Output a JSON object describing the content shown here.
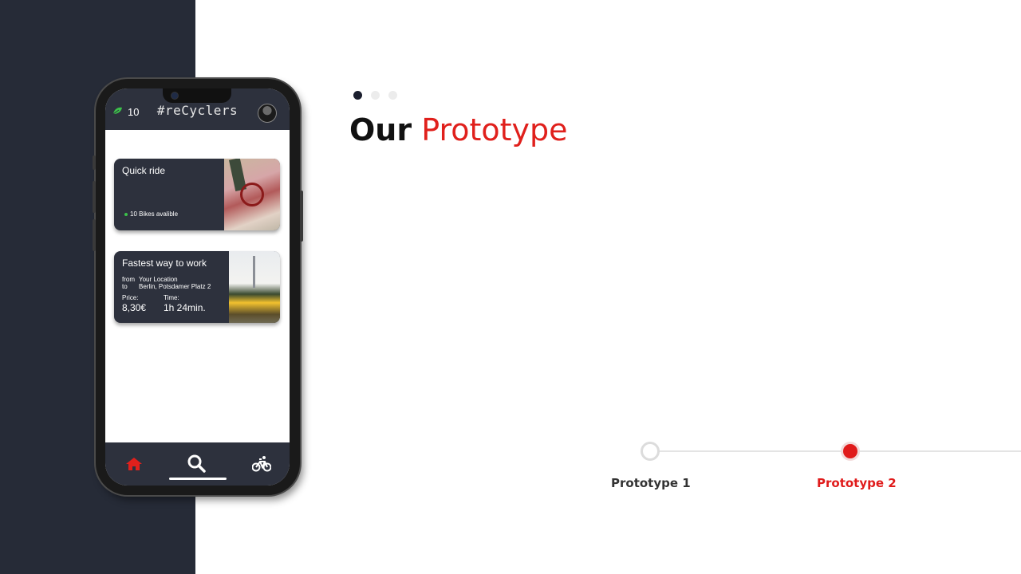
{
  "slide": {
    "title_bold": "Our",
    "title_accent": "Prototype",
    "accent_color": "#e0201c",
    "pager_dots": [
      {
        "active": true
      },
      {
        "active": false
      },
      {
        "active": false
      }
    ]
  },
  "phone": {
    "header": {
      "leaf_icon": "leaf-icon",
      "points": "10",
      "app_title": "#reCyclers",
      "avatar_icon": "user-avatar"
    },
    "cards": [
      {
        "title": "Quick ride",
        "status": "10 Bikes avalible",
        "status_color": "#3cc24a",
        "image": "folding-bike-photo"
      },
      {
        "title": "Fastest way to work",
        "from_label": "from",
        "from_value": "Your Location",
        "to_label": "to",
        "to_value": "Berlin, Potsdamer Platz 2",
        "price_label": "Price:",
        "price_value": "8,30€",
        "time_label": "Time:",
        "time_value": "1h 24min.",
        "image": "berlin-tram-photo"
      }
    ],
    "nav": [
      {
        "icon": "home-icon",
        "active": true,
        "color": "#e0201c"
      },
      {
        "icon": "search-icon",
        "active": false
      },
      {
        "icon": "bike-icon",
        "active": false
      }
    ]
  },
  "timeline": {
    "items": [
      {
        "label": "Prototype 1",
        "active": false
      },
      {
        "label": "Prototype 2",
        "active": true
      }
    ],
    "active_color": "#e01b1b",
    "inactive_text_color": "#333333"
  }
}
